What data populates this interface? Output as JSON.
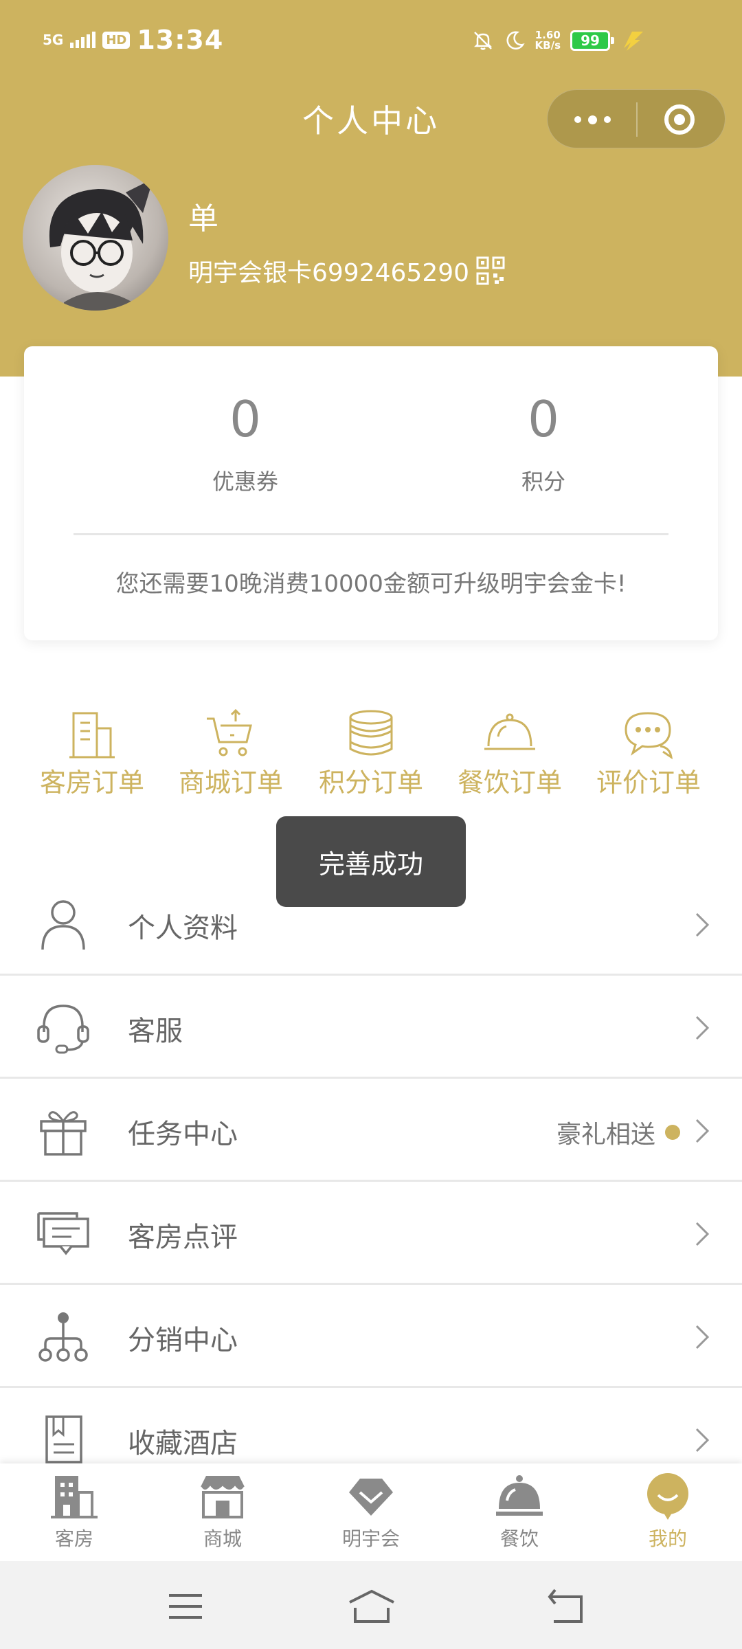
{
  "status_bar": {
    "network": "5G",
    "hd": "HD",
    "time": "13:34",
    "speed_value": "1.60",
    "speed_unit": "KB/s",
    "battery": "99"
  },
  "header": {
    "title": "个人中心"
  },
  "profile": {
    "name": "单",
    "card": "明宇会银卡6992465290"
  },
  "stats": {
    "coupons_value": "0",
    "coupons_label": "优惠券",
    "points_value": "0",
    "points_label": "积分",
    "upgrade_text": "您还需要10晚消费10000金额可升级明宇会金卡!"
  },
  "orders": [
    {
      "label": "客房订单",
      "icon": "building-icon"
    },
    {
      "label": "商城订单",
      "icon": "cart-icon"
    },
    {
      "label": "积分订单",
      "icon": "coins-icon"
    },
    {
      "label": "餐饮订单",
      "icon": "cloche-icon"
    },
    {
      "label": "评价订单",
      "icon": "chat-bubble-icon"
    }
  ],
  "toast": {
    "text": "完善成功"
  },
  "menu": [
    {
      "label": "个人资料",
      "icon": "person-icon"
    },
    {
      "label": "客服",
      "icon": "headset-icon"
    },
    {
      "label": "任务中心",
      "icon": "gift-icon",
      "extra": "豪礼相送"
    },
    {
      "label": "客房点评",
      "icon": "comments-icon"
    },
    {
      "label": "分销中心",
      "icon": "network-icon"
    },
    {
      "label": "收藏酒店",
      "icon": "bookmark-book-icon"
    }
  ],
  "tabbar": [
    {
      "label": "客房",
      "icon": "hotel-icon"
    },
    {
      "label": "商城",
      "icon": "shop-icon"
    },
    {
      "label": "明宇会",
      "icon": "diamond-icon"
    },
    {
      "label": "餐饮",
      "icon": "dining-icon"
    },
    {
      "label": "我的",
      "icon": "me-icon",
      "active": true
    }
  ],
  "colors": {
    "brand": "#cdb35f",
    "toast_bg": "#4a4a4a",
    "battery": "#2ec947"
  }
}
